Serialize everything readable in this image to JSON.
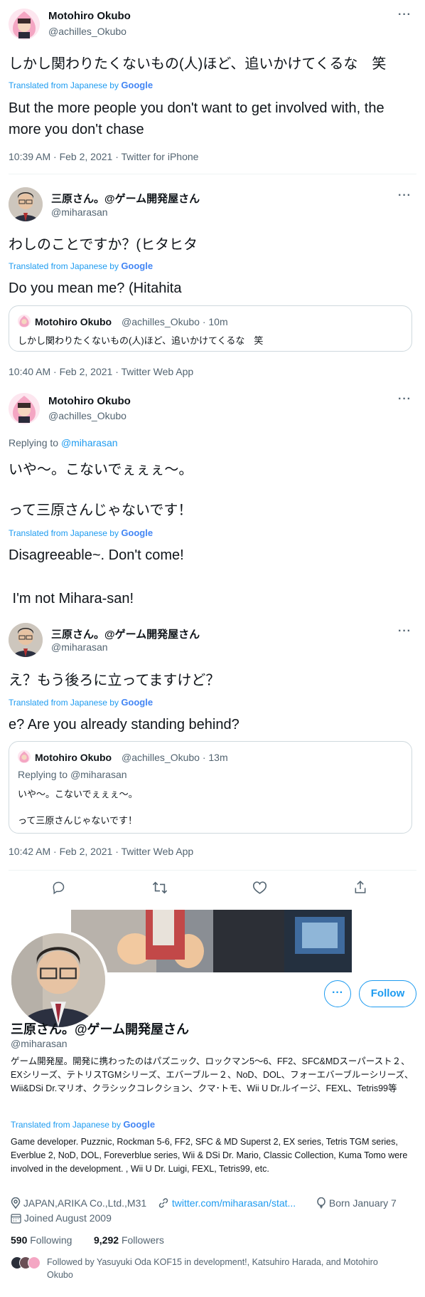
{
  "tweet1": {
    "name": "Motohiro Okubo",
    "handle": "@achilles_Okubo",
    "text_jp": "しかし関わりたくないもの(人)ほど、追いかけてくるな　笑",
    "translated_from": "Translated from Japanese by",
    "translated_en": "But the more people you don't want to get involved with, the more you don't chase",
    "meta": "10:39 AM · Feb 2, 2021 · Twitter for iPhone"
  },
  "tweet2": {
    "name": "三原さん。@ゲーム開発屋さん",
    "handle": "@miharasan",
    "text_jp": "わしのことですか？(ヒタヒタ",
    "translated_from": "Translated from Japanese by",
    "translated_en": "Do you mean me? (Hitahita",
    "quote": {
      "name": "Motohiro Okubo",
      "handle_time": "@achilles_Okubo · 10m",
      "text": "しかし関わりたくないもの(人)ほど、追いかけてくるな　笑"
    },
    "meta": "10:40 AM · Feb 2, 2021 · Twitter Web App"
  },
  "tweet3": {
    "name": "Motohiro Okubo",
    "handle": "@achilles_Okubo",
    "replying_prefix": "Replying to ",
    "replying_to": "@miharasan",
    "text_jp_1": "いや〜。こないでぇぇぇ〜。",
    "text_jp_2": "って三原さんじゃないです！",
    "translated_from": "Translated from Japanese by",
    "translated_en_1": "Disagreeable~. Don't come!",
    "translated_en_2": " I'm not Mihara-san!"
  },
  "tweet4": {
    "name": "三原さん。@ゲーム開発屋さん",
    "handle": "@miharasan",
    "text_jp": "え？もう後ろに立ってますけど？",
    "translated_from": "Translated from Japanese by",
    "translated_en": "e? Are you already standing behind?",
    "quote": {
      "name": "Motohiro Okubo",
      "handle_time": "@achilles_Okubo · 13m",
      "replying_prefix": "Replying to ",
      "replying_to": "@miharasan",
      "text_1": "いや〜。こないでぇぇぇ〜。",
      "text_2": "って三原さんじゃないです！"
    },
    "meta": "10:42 AM · Feb 2, 2021 · Twitter Web App"
  },
  "google": "Google",
  "profile": {
    "name": "三原さん。@ゲーム開発屋さん",
    "handle": "@miharasan",
    "follow_label": "Follow",
    "bio_jp": "ゲーム開発屋。開発に携わったのはパズニック、ロックマン5〜6、FF2、SFC&MDスーパースト２、EXシリーズ、テトリスTGMシリーズ、エバーブルー２、NoD、DOL、フォーエバーブルーシリーズ、Wii&DSi Dr.マリオ、クラシックコレクション、クマ･トモ、Wii U Dr.ルイージ、FEXL、Tetris99等",
    "translated_from": "Translated from Japanese by",
    "bio_en": "Game developer. Puzznic, Rockman 5-6, FF2, SFC & MD Superst 2, EX series, Tetris TGM series, Everblue 2, NoD, DOL, Foreverblue series, Wii & DSi Dr. Mario, Classic Collection, Kuma Tomo were involved in the development. , Wii U Dr. Luigi, FEXL, Tetris99, etc.",
    "location": "JAPAN,ARIKA Co.,Ltd.,M31",
    "link": "twitter.com/miharasan/stat...",
    "born": "Born January 7",
    "joined": "Joined August 2009",
    "following_count": "590",
    "following_label": "Following",
    "followers_count": "9,292",
    "followers_label": "Followers",
    "followed_by": "Followed by Yasuyuki Oda KOF15 in development!, Katsuhiro Harada, and Motohiro Okubo"
  },
  "colors": {
    "accent": "#1d9bf0",
    "text": "#0f1419",
    "muted": "#536471",
    "border": "#cfd9de"
  }
}
